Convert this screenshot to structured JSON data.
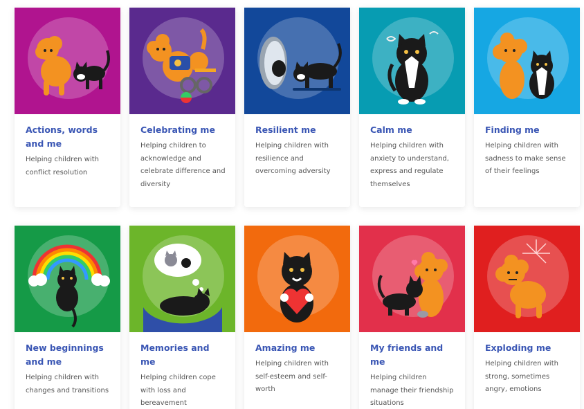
{
  "cards": [
    {
      "title": "Actions, words and me",
      "desc": "Helping children with conflict resolution",
      "bg": "#b0148f",
      "icon": "dog-and-cat-icon"
    },
    {
      "title": "Celebrating me",
      "desc": "Helping children to acknowledge and celebrate difference and diversity",
      "bg": "#5a2a8e",
      "icon": "dog-wheelchair-icon"
    },
    {
      "title": "Resilient me",
      "desc": "Helping children with resilience and overcoming adversity",
      "bg": "#12489a",
      "icon": "cat-mirror-icon"
    },
    {
      "title": "Calm me",
      "desc": "Helping children with anxiety to understand, express and regulate themselves",
      "bg": "#079cb2",
      "icon": "calm-cat-icon"
    },
    {
      "title": "Finding me",
      "desc": "Helping children with sadness to make sense of their feelings",
      "bg": "#16a7e3",
      "icon": "dog-and-cat-icon"
    },
    {
      "title": "New beginnings and me",
      "desc": "Helping children with changes and transitions",
      "bg": "#159a47",
      "icon": "rainbow-cat-icon"
    },
    {
      "title": "Memories and me",
      "desc": "Helping children cope with loss and bereavement",
      "bg": "#6cb52a",
      "icon": "dreaming-cat-icon"
    },
    {
      "title": "Amazing me",
      "desc": "Helping children with self-esteem and self-worth",
      "bg": "#f26a0d",
      "icon": "cat-heart-icon"
    },
    {
      "title": "My friends and me",
      "desc": "Helping children manage their friendship situations",
      "bg": "#e2304b",
      "icon": "dog-and-cat-icon"
    },
    {
      "title": "Exploding me",
      "desc": "Helping children with strong, sometimes angry, emotions",
      "bg": "#e01f1f",
      "icon": "exploding-dog-icon"
    }
  ]
}
